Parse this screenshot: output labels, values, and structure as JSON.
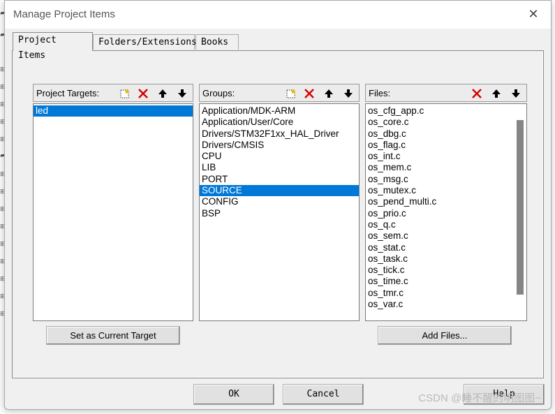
{
  "dialog": {
    "title": "Manage Project Items",
    "close_glyph": "✕"
  },
  "tabs": [
    {
      "label": "Project Items",
      "active": true
    },
    {
      "label": "Folders/Extensions",
      "active": false
    },
    {
      "label": "Books",
      "active": false
    }
  ],
  "targets": {
    "label": "Project Targets:",
    "items": [
      "led"
    ],
    "selected": 0
  },
  "groups": {
    "label": "Groups:",
    "items": [
      "Application/MDK-ARM",
      "Application/User/Core",
      "Drivers/STM32F1xx_HAL_Driver",
      "Drivers/CMSIS",
      "CPU",
      "LIB",
      "PORT",
      "SOURCE",
      "CONFIG",
      "BSP"
    ],
    "selected": 7
  },
  "files": {
    "label": "Files:",
    "items": [
      "os_cfg_app.c",
      "os_core.c",
      "os_dbg.c",
      "os_flag.c",
      "os_int.c",
      "os_mem.c",
      "os_msg.c",
      "os_mutex.c",
      "os_pend_multi.c",
      "os_prio.c",
      "os_q.c",
      "os_sem.c",
      "os_stat.c",
      "os_task.c",
      "os_tick.c",
      "os_time.c",
      "os_tmr.c",
      "os_var.c"
    ]
  },
  "buttons": {
    "set_current_target": "Set as Current Target",
    "add_files": "Add Files...",
    "ok": "OK",
    "cancel": "Cancel",
    "help": "Help"
  },
  "watermark": "CSDN @睡不醒的明图图~",
  "icons": {
    "new": "new-item-icon",
    "delete": "delete-icon",
    "up": "move-up-icon",
    "down": "move-down-icon"
  },
  "colors": {
    "selection": "#0078d7",
    "delete_red": "#d40000"
  }
}
